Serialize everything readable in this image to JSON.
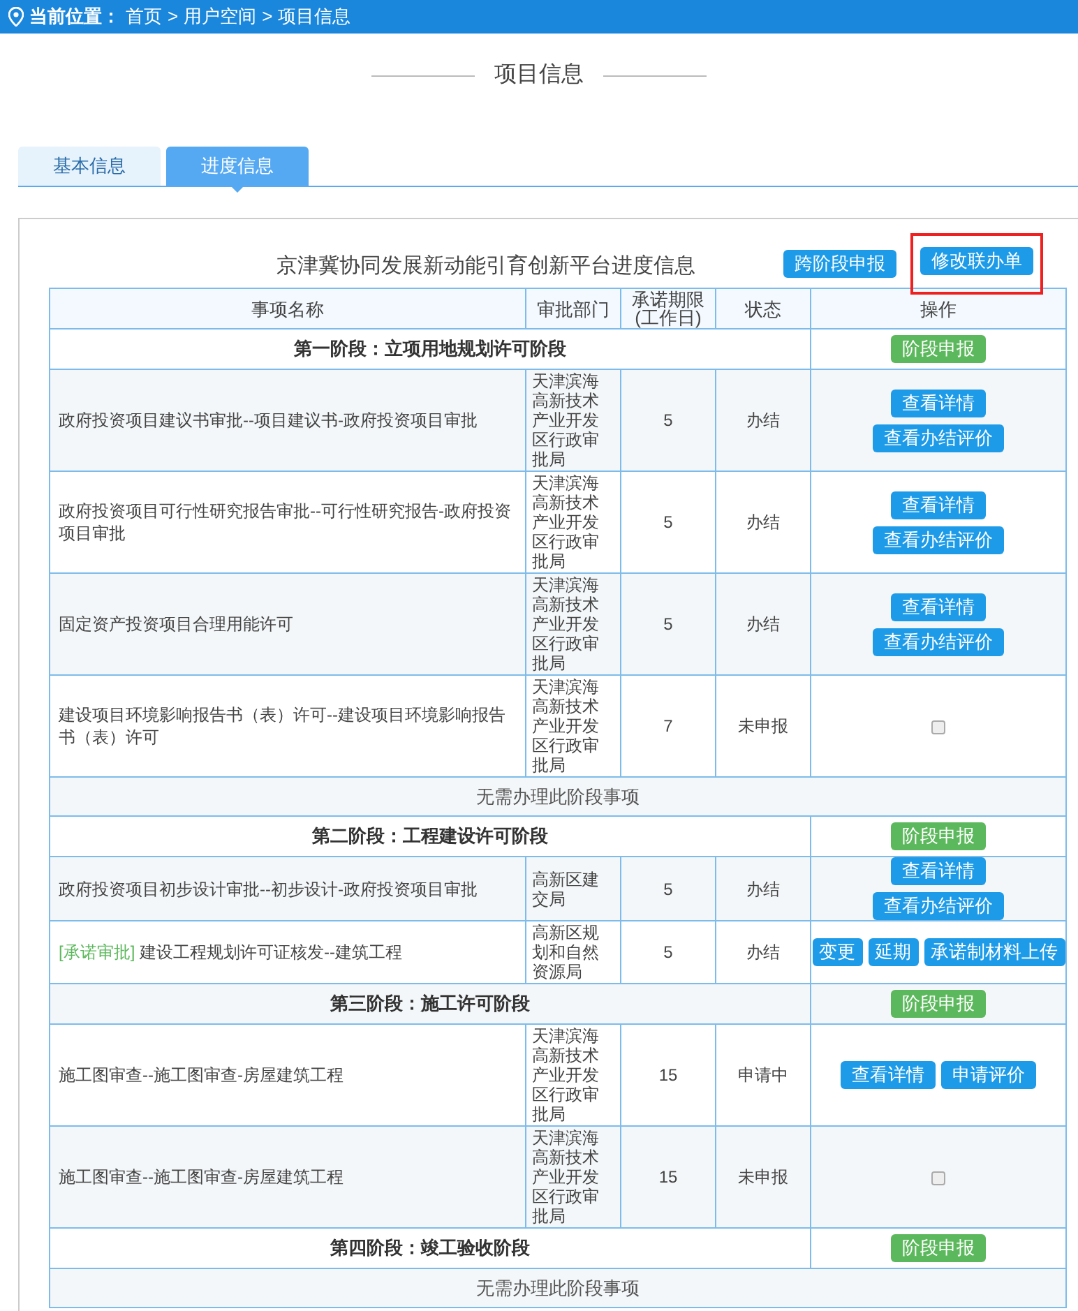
{
  "breadcrumb": {
    "label": "当前位置：",
    "separator": ">",
    "items": [
      "首页",
      "用户空间",
      "项目信息"
    ]
  },
  "page_title": "项目信息",
  "tabs": [
    {
      "label": "基本信息",
      "selected": false
    },
    {
      "label": "进度信息",
      "selected": true
    }
  ],
  "panel": {
    "title": "京津冀协同发展新动能引育创新平台进度信息",
    "buttons": [
      {
        "label": "跨阶段申报",
        "highlighted": false
      },
      {
        "label": "修改联办单",
        "highlighted": true
      }
    ]
  },
  "table": {
    "columns": [
      "事项名称",
      "审批部门",
      "承诺期限(工作日)",
      "状态",
      "操作"
    ],
    "rows": [
      {
        "kind": "stage",
        "title": "第一阶段：立项用地规划许可阶段",
        "actions": [
          "阶段申报"
        ]
      },
      {
        "kind": "item",
        "name": "政府投资项目建议书审批--项目建议书-政府投资项目审批",
        "dept": "天津滨海高新技术产业开发区行政审批局",
        "days": "5",
        "status": "办结",
        "actions": [
          "查看详情",
          "查看办结评价"
        ]
      },
      {
        "kind": "item",
        "name": "政府投资项目可行性研究报告审批--可行性研究报告-政府投资项目审批",
        "dept": "天津滨海高新技术产业开发区行政审批局",
        "days": "5",
        "status": "办结",
        "actions": [
          "查看详情",
          "查看办结评价"
        ]
      },
      {
        "kind": "item",
        "name": "固定资产投资项目合理用能许可",
        "dept": "天津滨海高新技术产业开发区行政审批局",
        "days": "5",
        "status": "办结",
        "actions": [
          "查看详情",
          "查看办结评价"
        ]
      },
      {
        "kind": "item",
        "name": "建设项目环境影响报告书（表）许可--建设项目环境影响报告书（表）许可",
        "dept": "天津滨海高新技术产业开发区行政审批局",
        "days": "7",
        "status": "未申报",
        "checked": false
      },
      {
        "kind": "note",
        "text": "无需办理此阶段事项"
      },
      {
        "kind": "stage",
        "title": "第二阶段：工程建设许可阶段",
        "actions": [
          "阶段申报"
        ]
      },
      {
        "kind": "item",
        "name": "政府投资项目初步设计审批--初步设计-政府投资项目审批",
        "dept": "高新区建交局",
        "days": "5",
        "status": "办结",
        "actions": [
          "查看详情",
          "查看办结评价"
        ]
      },
      {
        "kind": "item",
        "tag": "[承诺审批]",
        "name": "建设工程规划许可证核发--建筑工程",
        "dept": "高新区规划和自然资源局",
        "days": "5",
        "status": "办结",
        "actions": [
          "变更",
          "延期",
          "承诺制材料上传"
        ]
      },
      {
        "kind": "stage",
        "title": "第三阶段：施工许可阶段",
        "actions": [
          "阶段申报"
        ]
      },
      {
        "kind": "item",
        "name": "施工图审查--施工图审查-房屋建筑工程",
        "dept": "天津滨海高新技术产业开发区行政审批局",
        "days": "15",
        "status": "申请中",
        "actions": [
          "查看详情",
          "申请评价"
        ]
      },
      {
        "kind": "item",
        "name": "施工图审查--施工图审查-房屋建筑工程",
        "dept": "天津滨海高新技术产业开发区行政审批局",
        "days": "15",
        "status": "未申报",
        "checked": false
      },
      {
        "kind": "stage",
        "title": "第四阶段：竣工验收阶段",
        "actions": [
          "阶段申报"
        ]
      },
      {
        "kind": "note",
        "text": "无需办理此阶段事项"
      }
    ]
  }
}
